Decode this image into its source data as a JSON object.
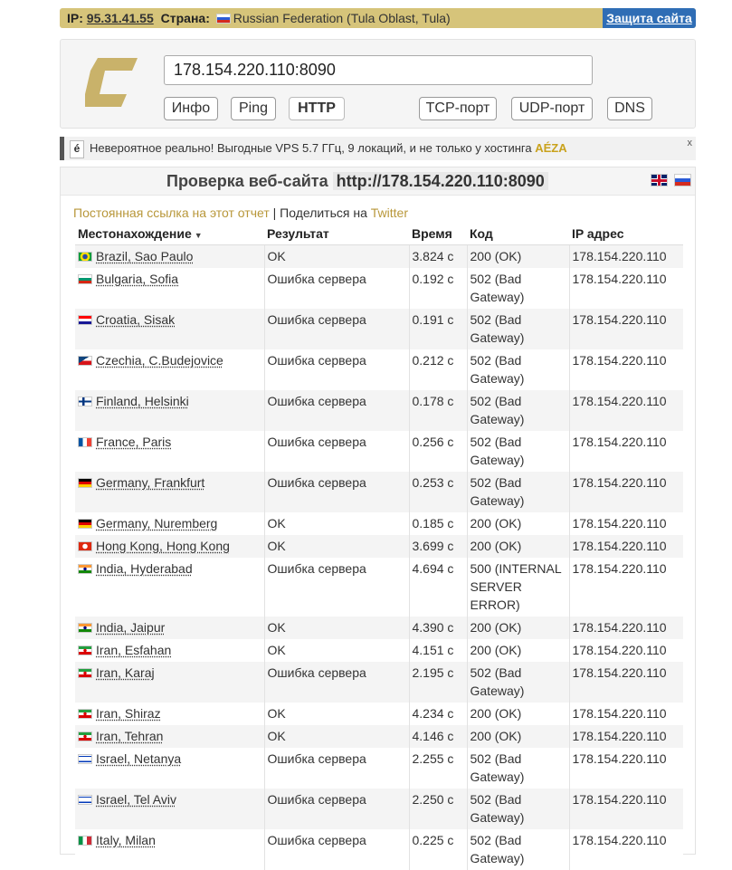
{
  "topbar": {
    "ip_label": "IP:",
    "ip_value": "95.31.41.55",
    "country_label": "Страна:",
    "country_value": "Russian Federation (Tula Oblast, Tula)",
    "protect_label": "Защита сайта"
  },
  "form": {
    "url_value": "178.154.220.110:8090",
    "buttons": [
      "Инфо",
      "Ping",
      "HTTP",
      "TCP-порт",
      "UDP-порт",
      "DNS"
    ],
    "active_button": "HTTP"
  },
  "promo": {
    "badge": "é",
    "text": "Невероятное реально! Выгодные VPS 5.7 ГГц, 9 локаций, и не только у хостинга",
    "brand": "AÉZA",
    "close": "x"
  },
  "card": {
    "title_label": "Проверка веб-сайта",
    "title_url": "http://178.154.220.110:8090",
    "permalink_text": "Постоянная ссылка на этот отчет",
    "separator": "|",
    "share_text": "Поделиться на",
    "share_link": "Twitter"
  },
  "table": {
    "headers": {
      "location": "Местонахождение",
      "result": "Результат",
      "time": "Время",
      "code": "Код",
      "ip": "IP адрес"
    },
    "rows": [
      {
        "flag": "br",
        "location": "Brazil, Sao Paulo",
        "result": "OK",
        "time": "3.824 с",
        "code": "200 (OK)",
        "ip": "178.154.220.110",
        "error": false
      },
      {
        "flag": "bg",
        "location": "Bulgaria, Sofia",
        "result": "Ошибка сервера",
        "time": "0.192 с",
        "code": "502 (Bad Gateway)",
        "ip": "178.154.220.110",
        "error": true
      },
      {
        "flag": "hr",
        "location": "Croatia, Sisak",
        "result": "Ошибка сервера",
        "time": "0.191 с",
        "code": "502 (Bad Gateway)",
        "ip": "178.154.220.110",
        "error": true
      },
      {
        "flag": "cz",
        "location": "Czechia, C.Budejovice",
        "result": "Ошибка сервера",
        "time": "0.212 с",
        "code": "502 (Bad Gateway)",
        "ip": "178.154.220.110",
        "error": true
      },
      {
        "flag": "fi",
        "location": "Finland, Helsinki",
        "result": "Ошибка сервера",
        "time": "0.178 с",
        "code": "502 (Bad Gateway)",
        "ip": "178.154.220.110",
        "error": true
      },
      {
        "flag": "fr",
        "location": "France, Paris",
        "result": "Ошибка сервера",
        "time": "0.256 с",
        "code": "502 (Bad Gateway)",
        "ip": "178.154.220.110",
        "error": true
      },
      {
        "flag": "de",
        "location": "Germany, Frankfurt",
        "result": "Ошибка сервера",
        "time": "0.253 с",
        "code": "502 (Bad Gateway)",
        "ip": "178.154.220.110",
        "error": true
      },
      {
        "flag": "de",
        "location": "Germany, Nuremberg",
        "result": "OK",
        "time": "0.185 с",
        "code": "200 (OK)",
        "ip": "178.154.220.110",
        "error": false
      },
      {
        "flag": "hk",
        "location": "Hong Kong, Hong Kong",
        "result": "OK",
        "time": "3.699 с",
        "code": "200 (OK)",
        "ip": "178.154.220.110",
        "error": false
      },
      {
        "flag": "in",
        "location": "India, Hyderabad",
        "result": "Ошибка сервера",
        "time": "4.694 с",
        "code": "500 (INTERNAL SERVER ERROR)",
        "ip": "178.154.220.110",
        "error": true
      },
      {
        "flag": "in",
        "location": "India, Jaipur",
        "result": "OK",
        "time": "4.390 с",
        "code": "200 (OK)",
        "ip": "178.154.220.110",
        "error": false
      },
      {
        "flag": "ir",
        "location": "Iran, Esfahan",
        "result": "OK",
        "time": "4.151 с",
        "code": "200 (OK)",
        "ip": "178.154.220.110",
        "error": false
      },
      {
        "flag": "ir",
        "location": "Iran, Karaj",
        "result": "Ошибка сервера",
        "time": "2.195 с",
        "code": "502 (Bad Gateway)",
        "ip": "178.154.220.110",
        "error": true
      },
      {
        "flag": "ir",
        "location": "Iran, Shiraz",
        "result": "OK",
        "time": "4.234 с",
        "code": "200 (OK)",
        "ip": "178.154.220.110",
        "error": false
      },
      {
        "flag": "ir",
        "location": "Iran, Tehran",
        "result": "OK",
        "time": "4.146 с",
        "code": "200 (OK)",
        "ip": "178.154.220.110",
        "error": false
      },
      {
        "flag": "il",
        "location": "Israel, Netanya",
        "result": "Ошибка сервера",
        "time": "2.255 с",
        "code": "502 (Bad Gateway)",
        "ip": "178.154.220.110",
        "error": true
      },
      {
        "flag": "il",
        "location": "Israel, Tel Aviv",
        "result": "Ошибка сервера",
        "time": "2.250 с",
        "code": "502 (Bad Gateway)",
        "ip": "178.154.220.110",
        "error": true
      },
      {
        "flag": "it",
        "location": "Italy, Milan",
        "result": "Ошибка сервера",
        "time": "0.225 с",
        "code": "502 (Bad Gateway)",
        "ip": "178.154.220.110",
        "error": true
      }
    ]
  }
}
